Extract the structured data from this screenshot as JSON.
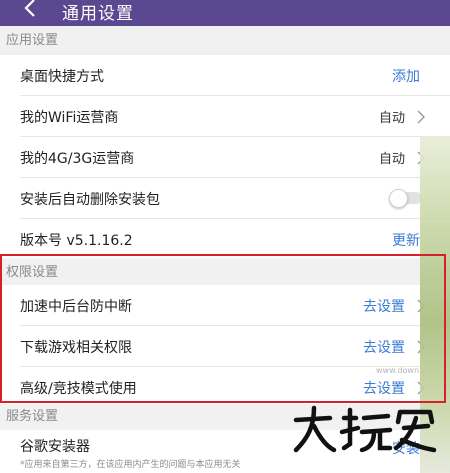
{
  "topbar": {
    "title": "通用设置"
  },
  "sections": {
    "app": "应用设置",
    "permission": "权限设置",
    "service": "服务设置"
  },
  "rows": {
    "desktop_shortcut": {
      "label": "桌面快捷方式",
      "action": "添加"
    },
    "wifi_carrier": {
      "label": "我的WiFi运营商",
      "value": "自动"
    },
    "mobile_carrier": {
      "label": "我的4G/3G运营商",
      "value": "自动"
    },
    "auto_delete": {
      "label": "安装后自动删除安装包"
    },
    "version": {
      "label": "版本号 v5.1.16.2",
      "action": "更新"
    },
    "accel_background": {
      "label": "加速中后台防中断",
      "action": "去设置"
    },
    "download_game_perm": {
      "label": "下载游戏相关权限",
      "action": "去设置"
    },
    "advanced_mode": {
      "label": "高级/竞技模式使用",
      "action": "去设置"
    },
    "google_installer": {
      "label": "谷歌安装器",
      "note": "*应用来自第三方，在该应用内产生的问题与本应用无关",
      "action": "安装"
    }
  },
  "toggle_state": {
    "auto_delete": false
  },
  "watermark": {
    "url": "www.down..."
  },
  "colors": {
    "topbar": "#5b4890",
    "link": "#3a7bd5",
    "highlight_border": "#d8202a",
    "section_bg": "#f1f1f1"
  },
  "icons": {
    "back": "back-arrow-icon",
    "chevron": "chevron-right-icon",
    "watermark": "watermark-logo"
  }
}
